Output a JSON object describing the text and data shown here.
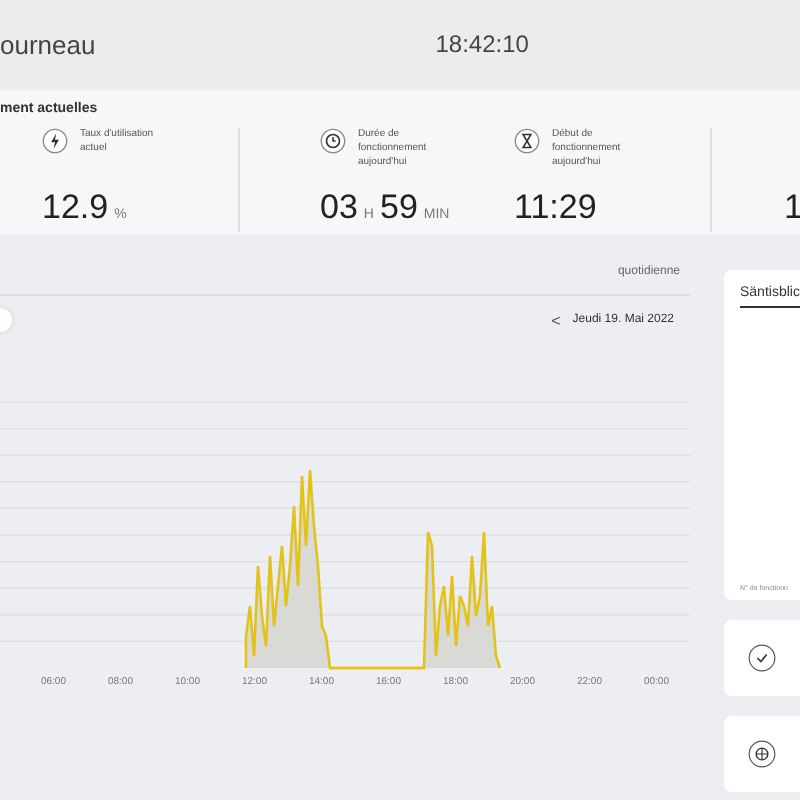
{
  "header": {
    "title": "ourneau",
    "time": "18:42:10"
  },
  "status": {
    "heading": "ment actuelles",
    "metrics": [
      {
        "kind": "bolt",
        "label": "Taux d'utilisation actuel",
        "parts": [
          {
            "kind": "number",
            "text": "12.9"
          },
          {
            "kind": "unit",
            "text": "%"
          }
        ]
      },
      {
        "kind": "clock",
        "label": "Durée de fonctionnement aujourd'hui",
        "parts": [
          {
            "kind": "number",
            "text": "03"
          },
          {
            "kind": "unit",
            "text": "H"
          },
          {
            "kind": "number",
            "text": "59"
          },
          {
            "kind": "unit",
            "text": "MIN"
          }
        ]
      },
      {
        "kind": "hourglass",
        "label": "Début de fonctionnement aujourd'hui",
        "parts": [
          {
            "kind": "number",
            "text": "11:29"
          }
        ]
      },
      {
        "kind": "plain",
        "parts": [
          {
            "kind": "number",
            "text": "1"
          }
        ]
      }
    ]
  },
  "chart_panel": {
    "period": "quotidienne",
    "prev": "<",
    "date": "Jeudi 19. Mai 2022",
    "x_labels": [
      "06:00",
      "08:00",
      "10:00",
      "12:00",
      "14:00",
      "16:00",
      "18:00",
      "20:00",
      "22:00",
      "00:00"
    ]
  },
  "side": {
    "tab": "Säntisblic",
    "footnote": "N° de fonctionn",
    "cards": [
      {
        "kind": "check"
      },
      {
        "kind": "globe"
      }
    ]
  }
}
